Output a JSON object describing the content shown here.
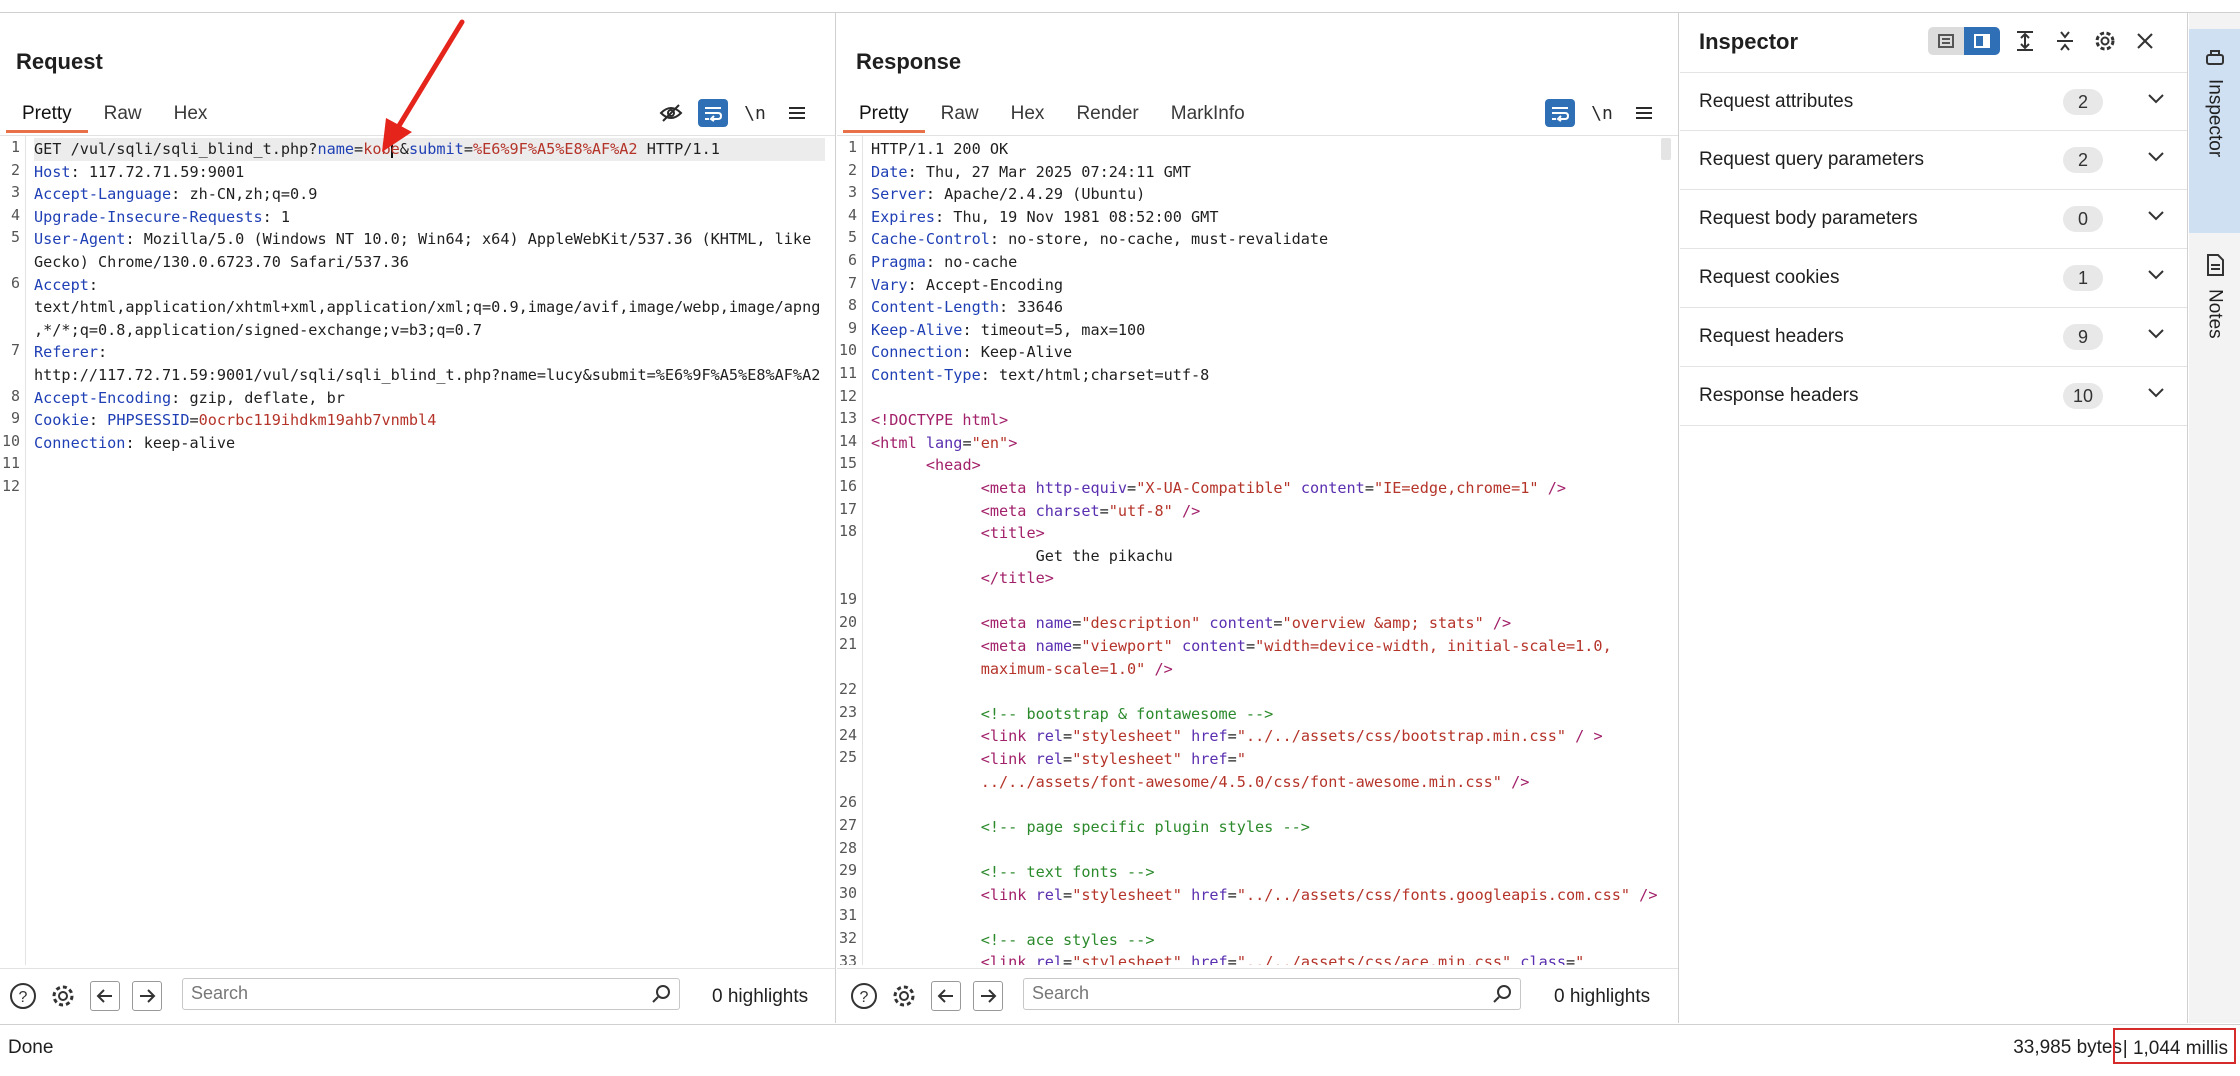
{
  "request": {
    "title": "Request",
    "tabs": [
      "Pretty",
      "Raw",
      "Hex"
    ],
    "active_tab": "Pretty",
    "lines": [
      {
        "n": "1",
        "html": "GET /vul/sqli/sqli_blind_t.php?<span class='k'>name</span>=<span class='v'>kobe</span>&amp;<span class='k'>submit</span>=<span class='v'>%E6%9F%A5%E8%AF%A2</span> HTTP/1.1",
        "hl": true
      },
      {
        "n": "2",
        "html": "<span class='k'>Host</span>: 117.72.71.59:9001"
      },
      {
        "n": "3",
        "html": "<span class='k'>Accept-Language</span>: zh-CN,zh;q=0.9"
      },
      {
        "n": "4",
        "html": "<span class='k'>Upgrade-Insecure-Requests</span>: 1"
      },
      {
        "n": "5",
        "html": "<span class='k'>User-Agent</span>: Mozilla/5.0 (Windows NT 10.0; Win64; x64) AppleWebKit/537.36 (KHTML, like"
      },
      {
        "n": "",
        "html": "Gecko) Chrome/130.0.6723.70 Safari/537.36"
      },
      {
        "n": "6",
        "html": "<span class='k'>Accept</span>:"
      },
      {
        "n": "",
        "html": "text/html,application/xhtml+xml,application/xml;q=0.9,image/avif,image/webp,image/apng"
      },
      {
        "n": "",
        "html": ",*/*;q=0.8,application/signed-exchange;v=b3;q=0.7"
      },
      {
        "n": "7",
        "html": "<span class='k'>Referer</span>:"
      },
      {
        "n": "",
        "html": "http://117.72.71.59:9001/vul/sqli/sqli_blind_t.php?name=lucy&amp;submit=%E6%9F%A5%E8%AF%A2"
      },
      {
        "n": "8",
        "html": "<span class='k'>Accept-Encoding</span>: gzip, deflate, br"
      },
      {
        "n": "9",
        "html": "<span class='k'>Cookie</span>: <span class='k'>PHPSESSID</span>=<span class='v'>0ocrbc119ihdkm19ahb7vnmbl4</span>"
      },
      {
        "n": "10",
        "html": "<span class='k'>Connection</span>: keep-alive"
      },
      {
        "n": "11",
        "html": ""
      },
      {
        "n": "12",
        "html": ""
      }
    ],
    "search_placeholder": "Search",
    "highlights": "0 highlights"
  },
  "response": {
    "title": "Response",
    "tabs": [
      "Pretty",
      "Raw",
      "Hex",
      "Render",
      "MarkInfo"
    ],
    "active_tab": "Pretty",
    "lines": [
      {
        "n": "1",
        "html": "HTTP/1.1 200 OK"
      },
      {
        "n": "2",
        "html": "<span class='k'>Date</span>: Thu, 27 Mar 2025 07:24:11 GMT"
      },
      {
        "n": "3",
        "html": "<span class='k'>Server</span>: Apache/2.4.29 (Ubuntu)"
      },
      {
        "n": "4",
        "html": "<span class='k'>Expires</span>: Thu, 19 Nov 1981 08:52:00 GMT"
      },
      {
        "n": "5",
        "html": "<span class='k'>Cache-Control</span>: no-store, no-cache, must-revalidate"
      },
      {
        "n": "6",
        "html": "<span class='k'>Pragma</span>: no-cache"
      },
      {
        "n": "7",
        "html": "<span class='k'>Vary</span>: Accept-Encoding"
      },
      {
        "n": "8",
        "html": "<span class='k'>Content-Length</span>: 33646"
      },
      {
        "n": "9",
        "html": "<span class='k'>Keep-Alive</span>: timeout=5, max=100"
      },
      {
        "n": "10",
        "html": "<span class='k'>Connection</span>: Keep-Alive"
      },
      {
        "n": "11",
        "html": "<span class='k'>Content-Type</span>: text/html;charset=utf-8"
      },
      {
        "n": "12",
        "html": ""
      },
      {
        "n": "13",
        "html": "<span class='t'>&lt;!DOCTYPE html&gt;</span>"
      },
      {
        "n": "14",
        "html": "<span class='t'>&lt;html</span> <span class='p'>lang</span>=<span class='v'>\"en\"</span><span class='t'>&gt;</span>"
      },
      {
        "n": "15",
        "html": "      <span class='t'>&lt;head&gt;</span>"
      },
      {
        "n": "16",
        "html": "            <span class='t'>&lt;meta</span> <span class='p'>http-equiv</span>=<span class='v'>\"X-UA-Compatible\"</span> <span class='p'>content</span>=<span class='v'>\"IE=edge,chrome=1\"</span> <span class='t'>/&gt;</span>"
      },
      {
        "n": "17",
        "html": "            <span class='t'>&lt;meta</span> <span class='p'>charset</span>=<span class='v'>\"utf-8\"</span> <span class='t'>/&gt;</span>"
      },
      {
        "n": "18",
        "html": "            <span class='t'>&lt;title&gt;</span>"
      },
      {
        "n": "",
        "html": "                  Get the pikachu"
      },
      {
        "n": "",
        "html": "            <span class='t'>&lt;/title&gt;</span>"
      },
      {
        "n": "19",
        "html": ""
      },
      {
        "n": "20",
        "html": "            <span class='t'>&lt;meta</span> <span class='p'>name</span>=<span class='v'>\"description\"</span> <span class='p'>content</span>=<span class='v'>\"overview &amp;amp; stats\"</span> <span class='t'>/&gt;</span>"
      },
      {
        "n": "21",
        "html": "            <span class='t'>&lt;meta</span> <span class='p'>name</span>=<span class='v'>\"viewport\"</span> <span class='p'>content</span>=<span class='v'>\"width=device-width, initial-scale=1.0,</span>"
      },
      {
        "n": "",
        "html": "            <span class='v'>maximum-scale=1.0\"</span> <span class='t'>/&gt;</span>"
      },
      {
        "n": "22",
        "html": ""
      },
      {
        "n": "23",
        "html": "            <span class='c'>&lt;!-- bootstrap &amp; fontawesome --&gt;</span>"
      },
      {
        "n": "24",
        "html": "            <span class='t'>&lt;link</span> <span class='p'>rel</span>=<span class='v'>\"stylesheet\"</span> <span class='p'>href</span>=<span class='v'>\"../../assets/css/bootstrap.min.css\"</span> <span class='t'>/ &gt;</span>"
      },
      {
        "n": "25",
        "html": "            <span class='t'>&lt;link</span> <span class='p'>rel</span>=<span class='v'>\"stylesheet\"</span> <span class='p'>href</span>=<span class='v'>\"</span>"
      },
      {
        "n": "",
        "html": "            <span class='v'>../../assets/font-awesome/4.5.0/css/font-awesome.min.css\"</span> <span class='t'>/&gt;</span>"
      },
      {
        "n": "26",
        "html": ""
      },
      {
        "n": "27",
        "html": "            <span class='c'>&lt;!-- page specific plugin styles --&gt;</span>"
      },
      {
        "n": "28",
        "html": ""
      },
      {
        "n": "29",
        "html": "            <span class='c'>&lt;!-- text fonts --&gt;</span>"
      },
      {
        "n": "30",
        "html": "            <span class='t'>&lt;link</span> <span class='p'>rel</span>=<span class='v'>\"stylesheet\"</span> <span class='p'>href</span>=<span class='v'>\"../../assets/css/fonts.googleapis.com.css\"</span> <span class='t'>/&gt;</span>"
      },
      {
        "n": "31",
        "html": ""
      },
      {
        "n": "32",
        "html": "            <span class='c'>&lt;!-- ace styles --&gt;</span>"
      },
      {
        "n": "33",
        "html": "            <span class='t'>&lt;link</span> <span class='p'>rel</span>=<span class='v'>\"stylesheet\"</span> <span class='p'>href</span>=<span class='v'>\"../../assets/css/ace.min.css\"</span> <span class='p'>class</span>=<span class='v'>\"</span>"
      }
    ],
    "search_placeholder": "Search",
    "highlights": "0 highlights"
  },
  "inspector": {
    "title": "Inspector",
    "items": [
      {
        "label": "Request attributes",
        "count": "2"
      },
      {
        "label": "Request query parameters",
        "count": "2"
      },
      {
        "label": "Request body parameters",
        "count": "0"
      },
      {
        "label": "Request cookies",
        "count": "1"
      },
      {
        "label": "Request headers",
        "count": "9"
      },
      {
        "label": "Response headers",
        "count": "10"
      }
    ]
  },
  "side_rail": {
    "tabs": [
      {
        "label": "Inspector",
        "icon": "inspector-icon",
        "active": true
      },
      {
        "label": "Notes",
        "icon": "notes-icon",
        "active": false
      }
    ]
  },
  "status": {
    "left": "Done",
    "bytes": "33,985 bytes",
    "millis": "| 1,044 millis"
  },
  "colors": {
    "accent": "#2f6fb5",
    "tab_underline": "#e8714a",
    "annotation_red": "#d62b2b"
  }
}
